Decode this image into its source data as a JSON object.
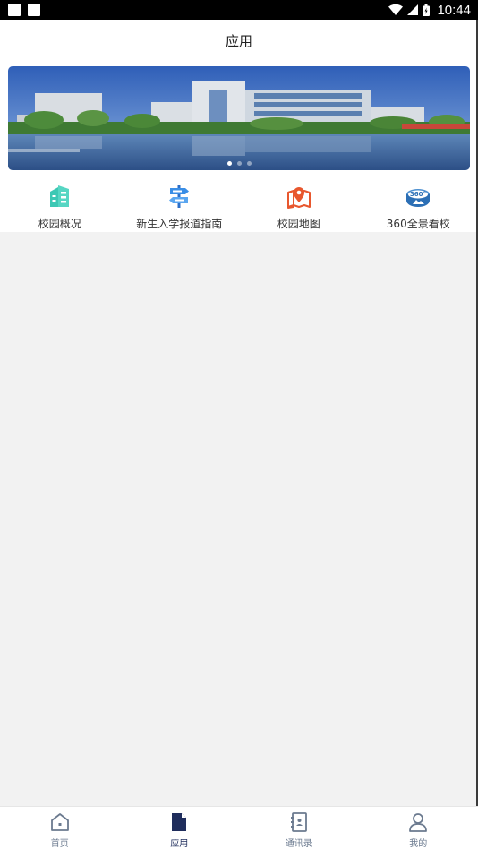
{
  "status_bar": {
    "time": "10:44",
    "icons": [
      "notification-icon",
      "notification-icon",
      "wifi-icon",
      "cell-signal-icon",
      "battery-icon"
    ]
  },
  "header": {
    "title": "应用"
  },
  "banner": {
    "image": "campus-building-photo",
    "dots": 3,
    "active_dot": 0
  },
  "apps": [
    {
      "label": "校园概况",
      "icon": "building-icon",
      "color": "#3cc8b4"
    },
    {
      "label": "新生入学报道指南",
      "icon": "signpost-icon",
      "color": "#3a8ee6"
    },
    {
      "label": "校园地图",
      "icon": "map-pin-icon",
      "color": "#e8572e"
    },
    {
      "label": "360全景看校",
      "icon": "panorama-360-icon",
      "color": "#2c6fb5"
    }
  ],
  "tabs": [
    {
      "label": "首页",
      "icon": "home-icon",
      "active": false
    },
    {
      "label": "应用",
      "icon": "document-icon",
      "active": true
    },
    {
      "label": "通讯录",
      "icon": "contacts-icon",
      "active": false
    },
    {
      "label": "我的",
      "icon": "user-icon",
      "active": false
    }
  ],
  "colors": {
    "tab_active": "#1f2d5c",
    "tab_inactive": "#6b7a8f",
    "background": "#f2f2f2"
  }
}
